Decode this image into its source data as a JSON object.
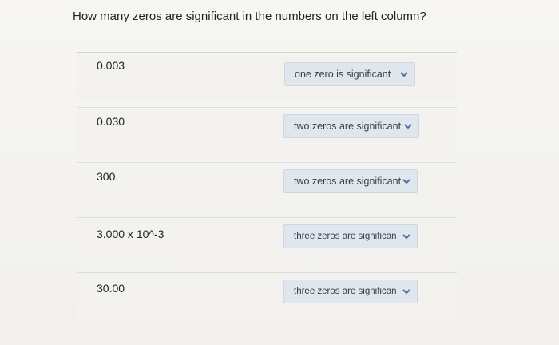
{
  "question": "How many zeros are significant in the numbers on the left column?",
  "rows": [
    {
      "value": "0.003",
      "selected": "one zero is significant"
    },
    {
      "value": "0.030",
      "selected": "two zeros are significant"
    },
    {
      "value": "300.",
      "selected": "two zeros are significant"
    },
    {
      "value": "3.000 x 10^-3",
      "selected": "three zeros are significan"
    },
    {
      "value": "30.00",
      "selected": "three zeros are significan"
    }
  ],
  "icons": {
    "dropdown": "chevron-down-icon"
  },
  "colors": {
    "dropdown_bg": "#dfe6ee",
    "chevron": "#4a6fa5",
    "background": "#f4f3ef"
  }
}
